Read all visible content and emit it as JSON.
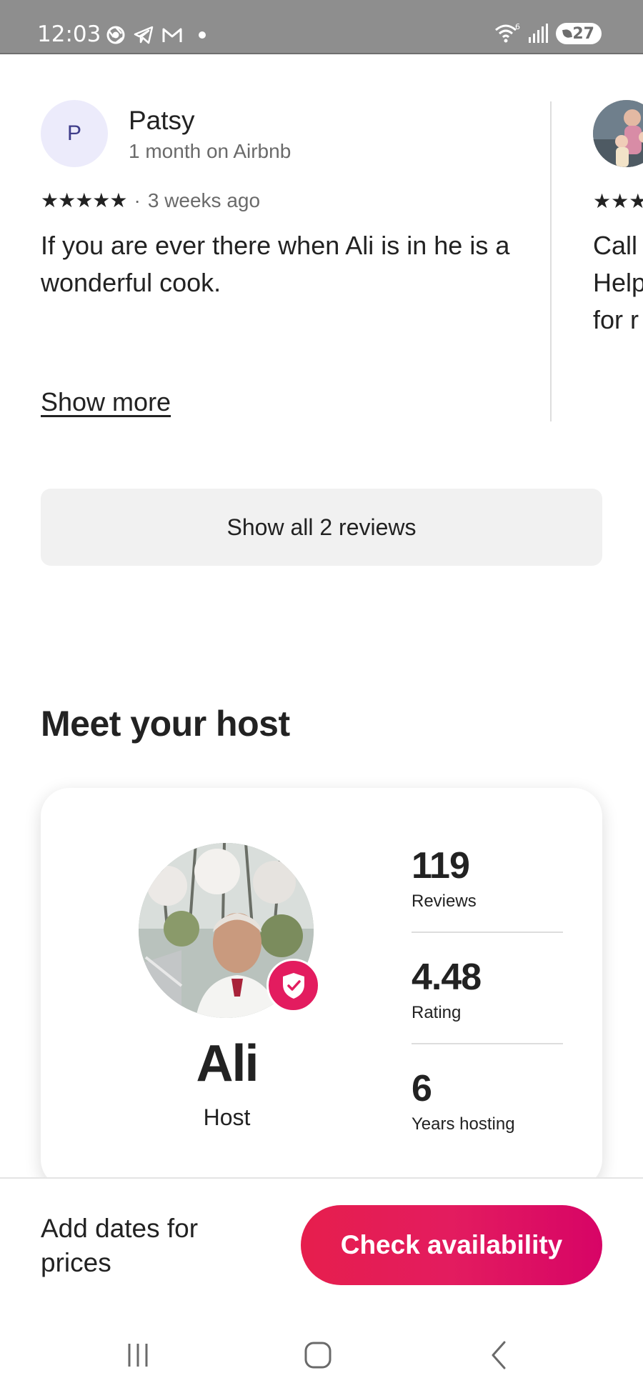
{
  "status_bar": {
    "time": "12:03",
    "wifi_superscript": "6",
    "battery": "27",
    "icons": [
      "chrome-icon",
      "telegram-icon",
      "gmail-icon",
      "notification-dot",
      "wifi-icon",
      "signal-icon",
      "battery-icon"
    ]
  },
  "review": {
    "avatar_initial": "P",
    "name": "Patsy",
    "meta": "1 month on Airbnb",
    "rating_stars": 5,
    "stars": "★★★★★",
    "separator": "·",
    "date": "3 weeks ago",
    "text": "If you are ever there when Ali is in he is a wonderful cook.",
    "show_more": "Show more"
  },
  "peek_review": {
    "stars": "★★★",
    "lines": [
      "Call",
      "Help",
      "for r"
    ]
  },
  "show_all_reviews": "Show all 2 reviews",
  "host_section": {
    "title": "Meet your host",
    "name": "Ali",
    "role": "Host",
    "stats": [
      {
        "value": "119",
        "label": "Reviews"
      },
      {
        "value": "4.48",
        "label": "Rating"
      },
      {
        "value": "6",
        "label": "Years hosting"
      }
    ]
  },
  "footer": {
    "prompt": "Add dates for prices",
    "cta": "Check availability"
  },
  "colors": {
    "brand": "#e31c5f",
    "text": "#222222",
    "muted": "#6a6a6a",
    "status_bar": "#8e8e8e"
  }
}
